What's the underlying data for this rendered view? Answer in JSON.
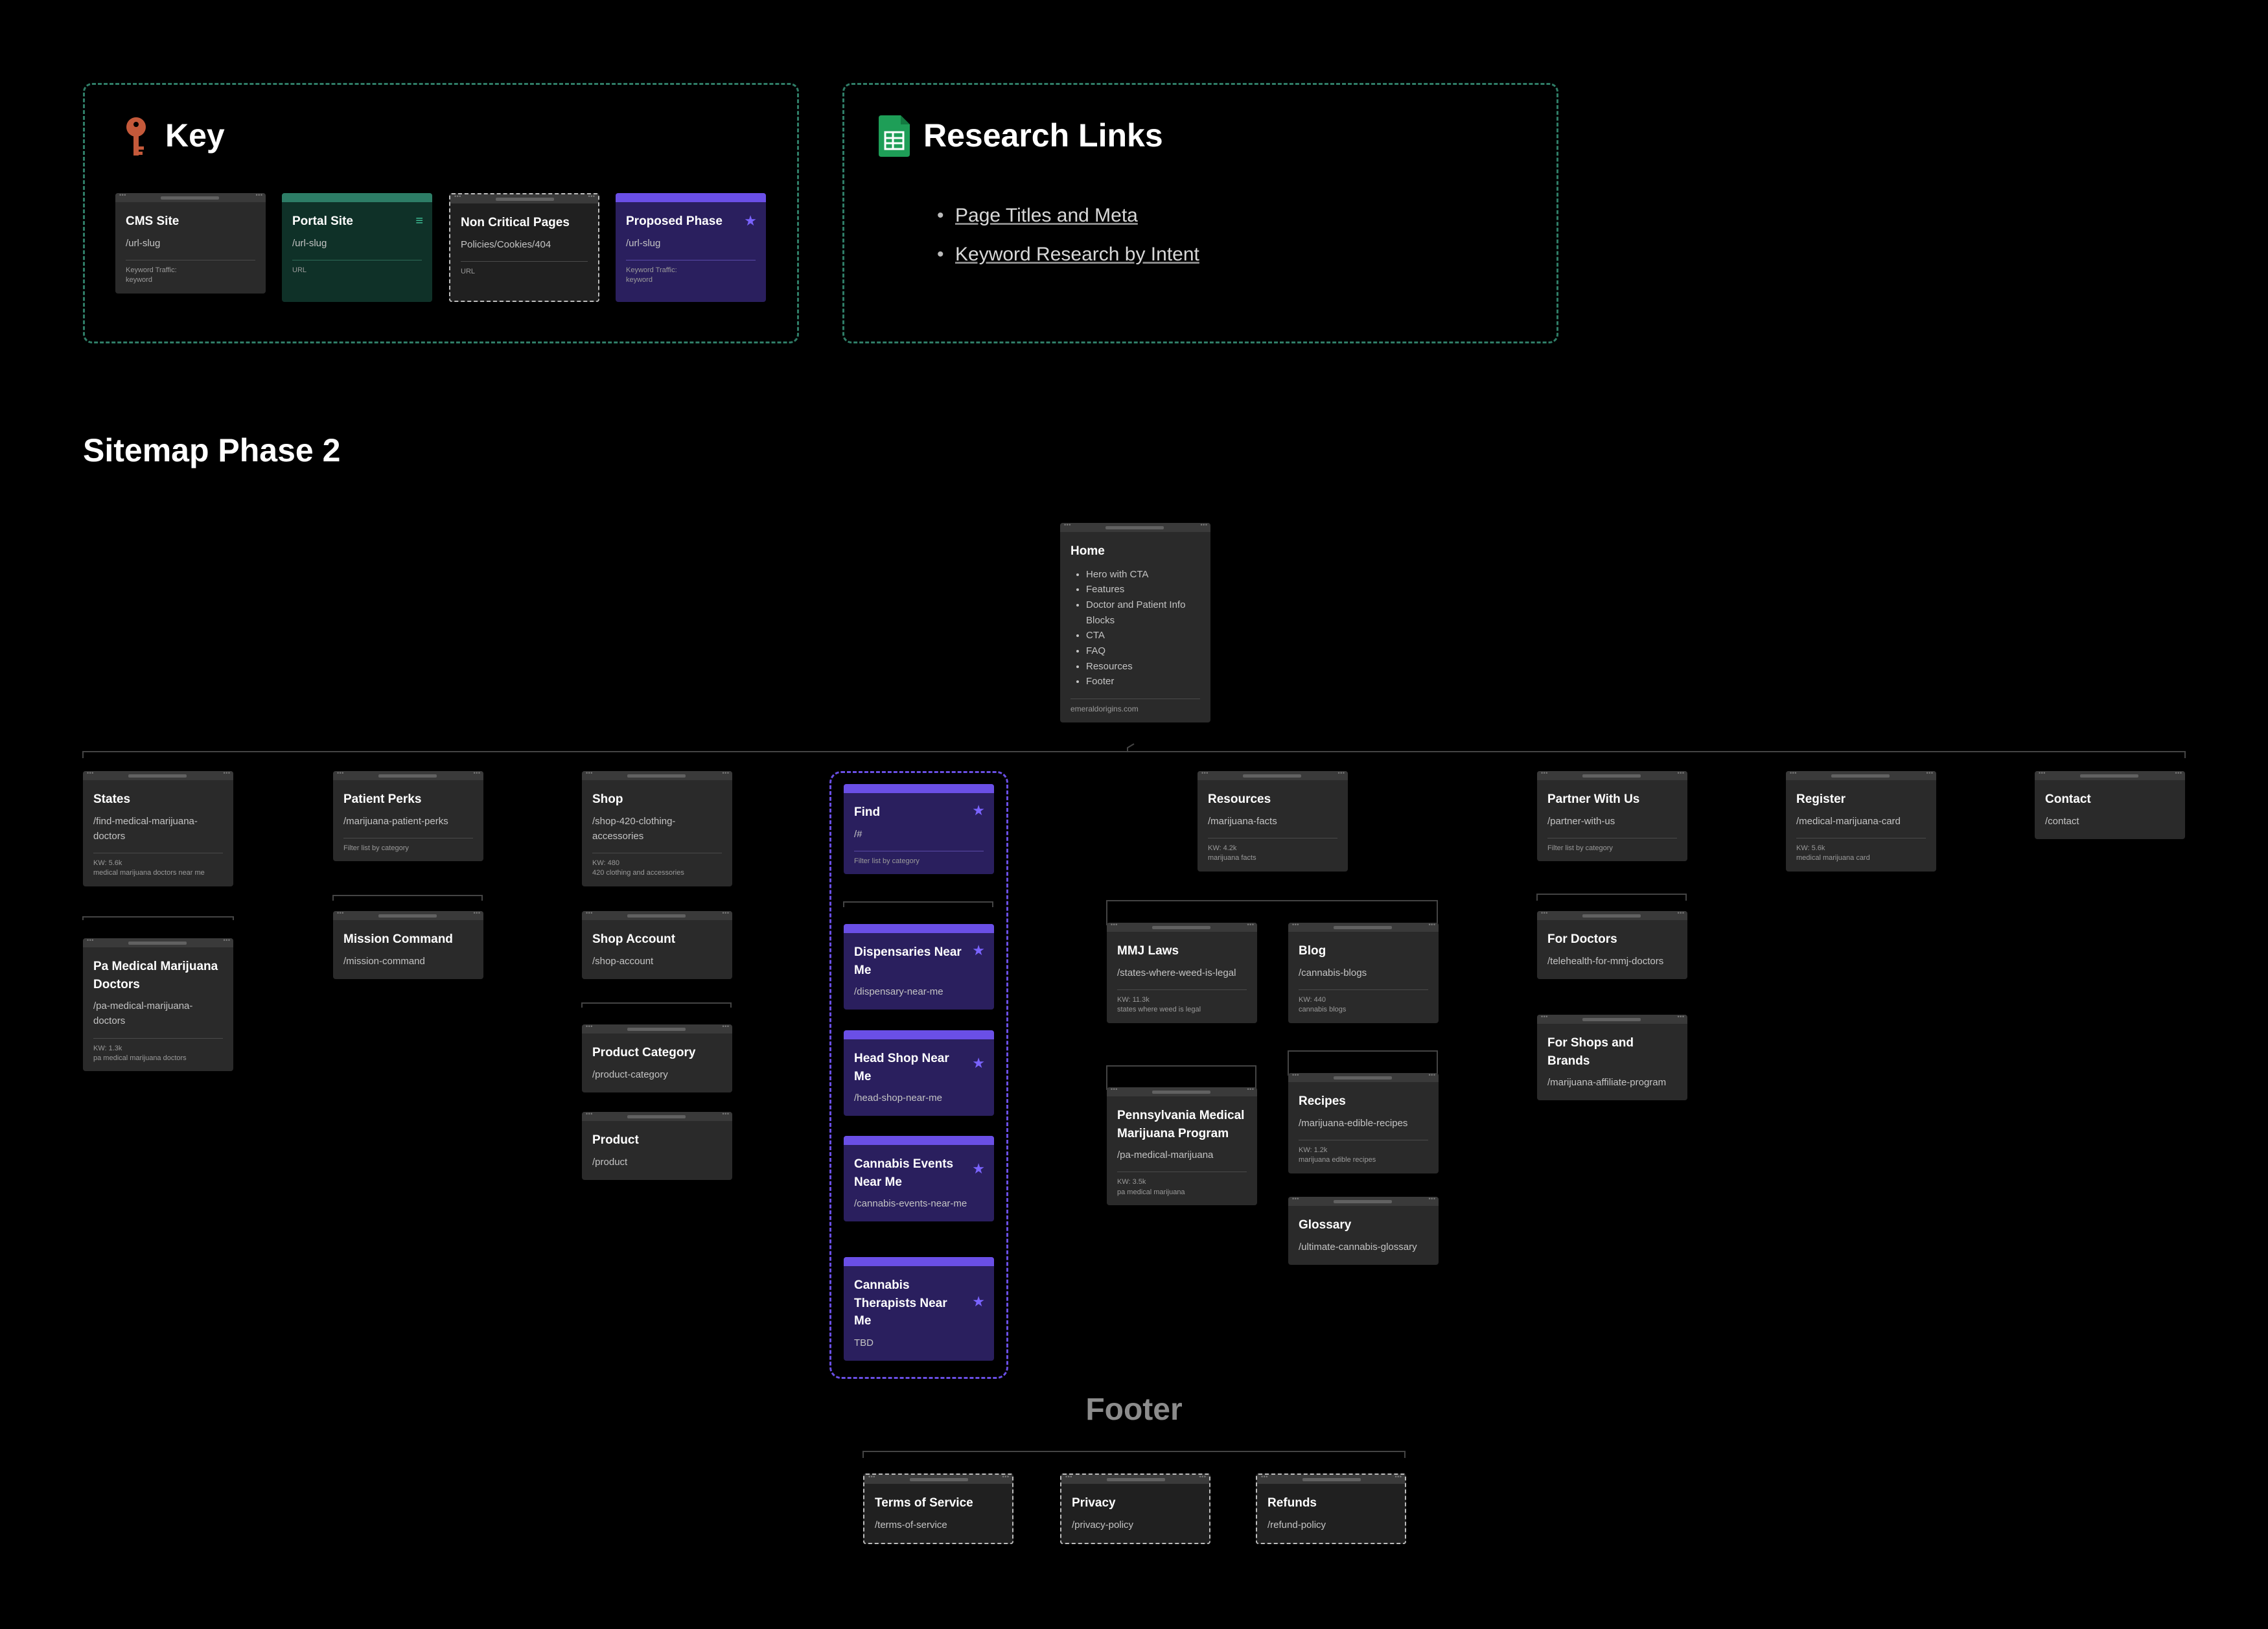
{
  "key": {
    "title": "Key",
    "items": [
      {
        "title": "CMS Site",
        "url": "/url-slug",
        "note": "Keyword Traffic:\nkeyword"
      },
      {
        "title": "Portal Site",
        "url": "/url-slug",
        "note": "URL"
      },
      {
        "title": "Non Critical Pages",
        "url": "Policies/Cookies/404",
        "note": "URL"
      },
      {
        "title": "Proposed Phase",
        "url": "/url-slug",
        "note": "Keyword Traffic:\nkeyword"
      }
    ]
  },
  "research": {
    "title": "Research Links",
    "links": [
      "Page Titles and Meta",
      "Keyword Research by Intent"
    ]
  },
  "sitemap": {
    "title": "Sitemap Phase 2",
    "home": {
      "title": "Home",
      "items": [
        "Hero with CTA",
        "Features",
        "Doctor and Patient Info Blocks",
        "CTA",
        "FAQ",
        "Resources",
        "Footer"
      ],
      "domain": "emeraldorigins.com"
    },
    "states": {
      "title": "States",
      "url": "/find-medical-marijuana-doctors",
      "kw": "KW: 5.6k",
      "kw_term": "medical marijuana doctors near me"
    },
    "pa_doctors": {
      "title": "Pa Medical Marijuana Doctors",
      "url": "/pa-medical-marijuana-doctors",
      "kw": "KW: 1.3k",
      "kw_term": "pa medical marijuana doctors"
    },
    "perks": {
      "title": "Patient Perks",
      "url": "/marijuana-patient-perks",
      "note": "Filter list by category"
    },
    "mission": {
      "title": "Mission Command",
      "url": "/mission-command"
    },
    "shop": {
      "title": "Shop",
      "url": "/shop-420-clothing-accessories",
      "kw": "KW: 480",
      "kw_term": "420 clothing and accessories"
    },
    "shop_account": {
      "title": "Shop Account",
      "url": "/shop-account"
    },
    "product_category": {
      "title": "Product Category",
      "url": "/product-category"
    },
    "product": {
      "title": "Product",
      "url": "/product"
    },
    "find": {
      "title": "Find",
      "url": "/#",
      "note": "Filter list by category"
    },
    "dispensaries": {
      "title": "Dispensaries Near Me",
      "url": "/dispensary-near-me"
    },
    "headshop": {
      "title": "Head Shop Near Me",
      "url": "/head-shop-near-me"
    },
    "events": {
      "title": "Cannabis Events Near Me",
      "url": "/cannabis-events-near-me"
    },
    "therapists": {
      "title": "Cannabis Therapists Near Me",
      "url": "TBD"
    },
    "resources": {
      "title": "Resources",
      "url": "/marijuana-facts",
      "kw": "KW: 4.2k",
      "kw_term": "marijuana facts"
    },
    "mmj": {
      "title": "MMJ Laws",
      "url": "/states-where-weed-is-legal",
      "kw": "KW: 11.3k",
      "kw_term": "states where weed is legal"
    },
    "pa_program": {
      "title": "Pennsylvania Medical Marijuana Program",
      "url": "/pa-medical-marijuana",
      "kw": "KW: 3.5k",
      "kw_term": "pa medical marijuana"
    },
    "blog": {
      "title": "Blog",
      "url": "/cannabis-blogs",
      "kw": "KW: 440",
      "kw_term": "cannabis blogs"
    },
    "recipes": {
      "title": "Recipes",
      "url": "/marijuana-edible-recipes",
      "kw": "KW: 1.2k",
      "kw_term": "marijuana edible recipes"
    },
    "glossary": {
      "title": "Glossary",
      "url": "/ultimate-cannabis-glossary"
    },
    "partner": {
      "title": "Partner With Us",
      "url": "/partner-with-us",
      "note": "Filter list by category"
    },
    "for_doctors": {
      "title": "For Doctors",
      "url": "/telehealth-for-mmj-doctors"
    },
    "for_shops": {
      "title": "For Shops and Brands",
      "url": "/marijuana-affiliate-program"
    },
    "register": {
      "title": "Register",
      "url": "/medical-marijuana-card",
      "kw": "KW: 5.6k",
      "kw_term": "medical marijuana card"
    },
    "contact": {
      "title": "Contact",
      "url": "/contact"
    }
  },
  "footer": {
    "title": "Footer",
    "items": [
      {
        "title": "Terms of Service",
        "url": "/terms-of-service"
      },
      {
        "title": "Privacy",
        "url": "/privacy-policy"
      },
      {
        "title": "Refunds",
        "url": "/refund-policy"
      }
    ]
  }
}
